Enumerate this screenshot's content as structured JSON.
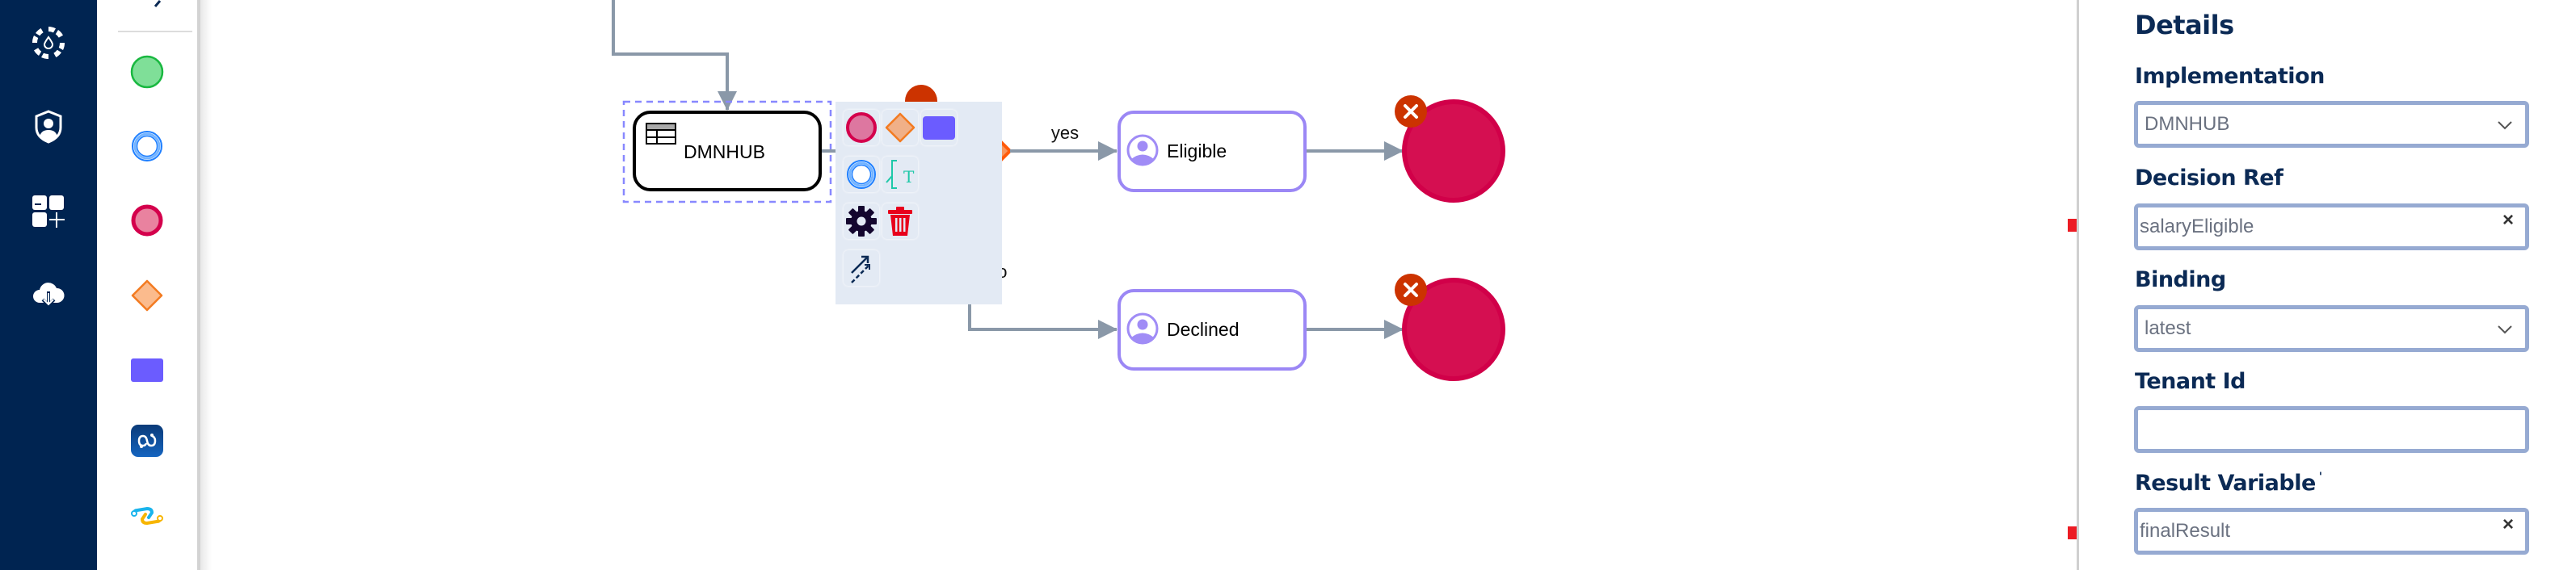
{
  "nav": {
    "items": [
      {
        "name": "camunda-engine",
        "icon": "gear-drop-icon"
      },
      {
        "name": "user-shield",
        "icon": "shield-user-icon"
      },
      {
        "name": "add-widgets",
        "icon": "grid-plus-icon"
      },
      {
        "name": "cloud-download",
        "icon": "cloud-download-icon"
      }
    ]
  },
  "palette": {
    "items": [
      {
        "name": "start-event",
        "icon": "green-circle-icon"
      },
      {
        "name": "intermediate-event",
        "icon": "blue-ring-icon"
      },
      {
        "name": "end-event",
        "icon": "red-circle-icon"
      },
      {
        "name": "gateway",
        "icon": "orange-diamond-icon"
      },
      {
        "name": "task",
        "icon": "purple-rect-icon"
      },
      {
        "name": "subprocess",
        "icon": "infinity-tile-icon"
      },
      {
        "name": "connector",
        "icon": "chain-link-icon"
      }
    ]
  },
  "diagram": {
    "task_dmn": {
      "label": "DMNHUB",
      "type": "business-rule-task"
    },
    "gateway": {
      "type": "exclusive-gateway"
    },
    "flow_yes": {
      "label": "yes"
    },
    "flow_no": {
      "label": "no"
    },
    "task_eligible": {
      "label": "Eligible",
      "type": "user-task"
    },
    "task_declined": {
      "label": "Declined",
      "type": "user-task"
    },
    "end_events": [
      {
        "type": "terminate-end"
      },
      {
        "type": "terminate-end"
      }
    ],
    "colors": {
      "flow": "#8a98a8",
      "gateway_fill": "#f7955d",
      "gateway_stroke": "#ff5a0a",
      "user_task_stroke": "#9b87f5",
      "end_fill": "#d50f51",
      "badge": "#cc3300",
      "selection": "#8888ff"
    }
  },
  "context_pad": {
    "items": [
      {
        "name": "append-end-event",
        "icon": "red-circle-icon"
      },
      {
        "name": "append-gateway",
        "icon": "orange-diamond-icon"
      },
      {
        "name": "append-task",
        "icon": "purple-rect-icon"
      },
      {
        "name": "append-intermediate-event",
        "icon": "blue-ring-icon"
      },
      {
        "name": "append-text-annotation",
        "icon": "text-annotation-icon"
      },
      {
        "name": "change-type",
        "icon": "gear-icon"
      },
      {
        "name": "delete",
        "icon": "trash-icon"
      },
      {
        "name": "connect",
        "icon": "connect-arrows-icon"
      }
    ]
  },
  "details": {
    "title": "Details",
    "fields": [
      {
        "label": "Implementation",
        "value": "DMNHUB",
        "kind": "select"
      },
      {
        "label": "Decision Ref",
        "value": "salaryEligible",
        "kind": "text-clearable"
      },
      {
        "label": "Binding",
        "value": "latest",
        "kind": "select"
      },
      {
        "label": "Tenant Id",
        "value": "",
        "kind": "text"
      },
      {
        "label": "Result Variable",
        "value": "finalResult",
        "kind": "text-clearable"
      }
    ],
    "clear_symbol": "×"
  },
  "annotations": {
    "arrow_color": "#ec1c24",
    "highlighted_fields": [
      "Decision Ref",
      "Result Variable"
    ]
  }
}
